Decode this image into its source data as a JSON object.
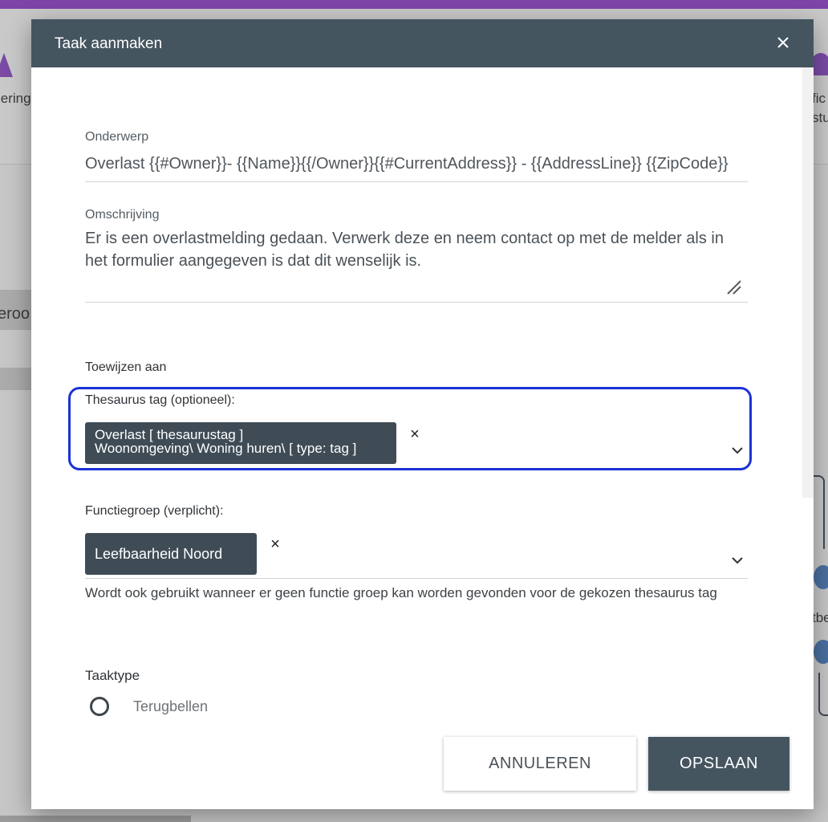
{
  "background": {
    "left_label_1": "lering",
    "left_label_2": "eroo",
    "right_label_1": "fic",
    "right_label_2": "stu",
    "right_label_3": "tbe"
  },
  "dialog": {
    "title": "Taak aanmaken",
    "close_icon": "close-icon",
    "subject": {
      "label": "Onderwerp",
      "value": "Overlast {{#Owner}}- {{Name}}{{/Owner}}{{#CurrentAddress}} - {{AddressLine}} {{ZipCode}}"
    },
    "description": {
      "label": "Omschrijving",
      "value": "Er is een overlastmelding gedaan. Verwerk deze en neem contact op met de melder als in het formulier aangegeven is dat dit wenselijk is."
    },
    "assign_heading": "Toewijzen aan",
    "thesaurus": {
      "label": "Thesaurus tag (optioneel):",
      "chip_line1": "Overlast [ thesaurustag ]",
      "chip_line2": "Woonomgeving\\ Woning huren\\ [ type: tag ]",
      "remove_label": "×"
    },
    "functiegroep": {
      "label": "Functiegroep (verplicht):",
      "chip": "Leefbaarheid Noord",
      "remove_label": "×",
      "help": "Wordt ook gebruikt wanneer er geen functie groep kan worden gevonden voor de gekozen thesaurus tag"
    },
    "taaktype": {
      "label": "Taaktype",
      "options": [
        "Terugbellen"
      ]
    },
    "buttons": {
      "cancel": "ANNULEREN",
      "save": "OPSLAAN"
    }
  },
  "colors": {
    "header": "#455560",
    "focus_ring": "#1b33d6",
    "chip": "#3f4c56",
    "app_bar": "#7e44a8"
  }
}
